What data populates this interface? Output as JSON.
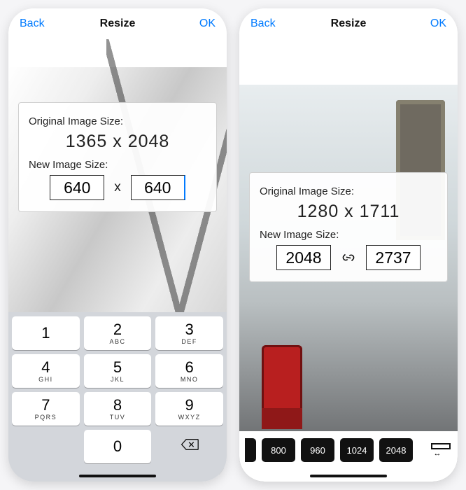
{
  "left": {
    "nav": {
      "back": "Back",
      "title": "Resize",
      "ok": "OK"
    },
    "card": {
      "orig_label": "Original Image Size:",
      "orig_size": "1365 x 2048",
      "new_label": "New Image Size:",
      "width": "640",
      "height": "640",
      "sep": "x"
    },
    "keypad": {
      "keys": [
        {
          "n": "1",
          "s": ""
        },
        {
          "n": "2",
          "s": "ABC"
        },
        {
          "n": "3",
          "s": "DEF"
        },
        {
          "n": "4",
          "s": "GHI"
        },
        {
          "n": "5",
          "s": "JKL"
        },
        {
          "n": "6",
          "s": "MNO"
        },
        {
          "n": "7",
          "s": "PQRS"
        },
        {
          "n": "8",
          "s": "TUV"
        },
        {
          "n": "9",
          "s": "WXYZ"
        }
      ],
      "zero": "0"
    }
  },
  "right": {
    "nav": {
      "back": "Back",
      "title": "Resize",
      "ok": "OK"
    },
    "card": {
      "orig_label": "Original Image Size:",
      "orig_size": "1280 x 1711",
      "new_label": "New Image Size:",
      "width": "2048",
      "height": "2737"
    },
    "presets": [
      "800",
      "960",
      "1024",
      "2048"
    ]
  }
}
